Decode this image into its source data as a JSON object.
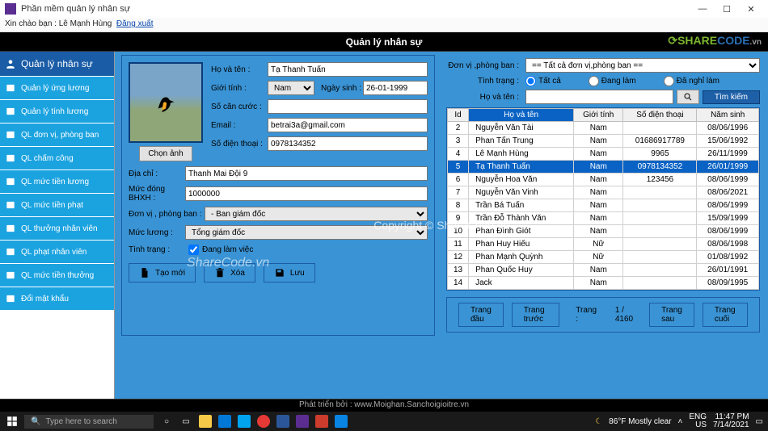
{
  "window": {
    "title": "Phần mềm quản lý nhân sự",
    "greeting_prefix": "Xin chào bạn : ",
    "greeting_user": "Lê Mạnh Hùng",
    "logout": "Đăng xuất"
  },
  "header": {
    "title": "Quản lý nhân sự"
  },
  "brand": {
    "share": "SHARE",
    "code": "CODE",
    "vn": ".vn"
  },
  "sidebar": {
    "head": "Quản lý nhân sự",
    "items": [
      {
        "label": "Quản lý ứng lương"
      },
      {
        "label": "Quản lý tính lương"
      },
      {
        "label": "QL đơn vị, phòng ban"
      },
      {
        "label": "QL chấm công"
      },
      {
        "label": "QL mức tiền lương"
      },
      {
        "label": "QL mức tiền phạt"
      },
      {
        "label": "QL thưởng nhân viên"
      },
      {
        "label": "QL phạt nhân viên"
      },
      {
        "label": "QL mức tiền thưởng"
      },
      {
        "label": "Đổi mật khẩu"
      }
    ]
  },
  "form": {
    "labels": {
      "hoten": "Họ và tên :",
      "gioitinh": "Giới tính :",
      "ngaysinh": "Ngày sinh :",
      "cccd": "Số căn cước :",
      "email": "Email :",
      "sdt": "Số điện thoại :",
      "diachi": "Địa chỉ :",
      "bhxh": "Mức đóng BHXH :",
      "donvi": "Đơn vị , phòng ban :",
      "luong": "Mức lương :",
      "tinhtrang": "Tình trạng :"
    },
    "values": {
      "hoten": "Tạ Thanh Tuấn",
      "gioitinh": "Nam",
      "ngaysinh": "26-01-1999",
      "cccd": "",
      "email": "betrai3a@gmail.com",
      "sdt": "0978134352",
      "diachi": "Thanh Mai Đội 9",
      "bhxh": "1000000",
      "donvi": "- Ban giám đốc",
      "luong": "Tổng giám đốc"
    },
    "chonanh": "Chọn ảnh",
    "workstatus": "Đang làm việc",
    "actions": {
      "new": "Tạo mới",
      "del": "Xóa",
      "save": "Lưu"
    }
  },
  "filters": {
    "labels": {
      "donvi": "Đơn vị ,phòng ban :",
      "tinhtrang": "Tình trạng :",
      "hoten": "Họ và tên :"
    },
    "donvi_value": "== Tất cả đơn vị,phòng ban ==",
    "radios": {
      "all": "Tất cả",
      "working": "Đang làm",
      "retired": "Đã nghỉ làm"
    },
    "search_btn": "Tìm kiếm"
  },
  "table": {
    "headers": [
      "Id",
      "Họ và tên",
      "Giới tính",
      "Số điện thoại",
      "Năm sinh"
    ],
    "rows": [
      {
        "id": "2",
        "name": "Nguyễn Văn Tài",
        "sex": "Nam",
        "phone": "",
        "dob": "08/06/1996"
      },
      {
        "id": "3",
        "name": "Phan Tấn Trung",
        "sex": "Nam",
        "phone": "01686917789",
        "dob": "15/06/1992"
      },
      {
        "id": "4",
        "name": "Lê Mạnh Hùng",
        "sex": "Nam",
        "phone": "9965",
        "dob": "26/11/1999"
      },
      {
        "id": "5",
        "name": "Tạ Thanh Tuấn",
        "sex": "Nam",
        "phone": "0978134352",
        "dob": "26/01/1999",
        "selected": true
      },
      {
        "id": "6",
        "name": "Nguyễn Hoa Văn",
        "sex": "Nam",
        "phone": "123456",
        "dob": "08/06/1999"
      },
      {
        "id": "7",
        "name": "Nguyễn Văn Vinh",
        "sex": "Nam",
        "phone": "",
        "dob": "08/06/2021"
      },
      {
        "id": "8",
        "name": "Trần Bá Tuấn",
        "sex": "Nam",
        "phone": "",
        "dob": "08/06/1999"
      },
      {
        "id": "9",
        "name": "Trần Đỗ Thành Văn",
        "sex": "Nam",
        "phone": "",
        "dob": "15/09/1999"
      },
      {
        "id": "10",
        "name": "Phan Đình Giót",
        "sex": "Nam",
        "phone": "",
        "dob": "08/06/1999"
      },
      {
        "id": "11",
        "name": "Phan Huy Hiếu",
        "sex": "Nữ",
        "phone": "",
        "dob": "08/06/1998"
      },
      {
        "id": "12",
        "name": "Phan Mạnh Quỳnh",
        "sex": "Nữ",
        "phone": "",
        "dob": "01/08/1992"
      },
      {
        "id": "13",
        "name": "Phan Quốc Huy",
        "sex": "Nam",
        "phone": "",
        "dob": "26/01/1991"
      },
      {
        "id": "14",
        "name": "Jack",
        "sex": "Nam",
        "phone": "",
        "dob": "08/09/1995"
      }
    ]
  },
  "pager": {
    "first": "Trang đầu",
    "prev": "Trang trước",
    "page_label": "Trang :",
    "page_value": "1 / 4160",
    "next": "Trang sau",
    "last": "Trang cuối"
  },
  "footerbar": "Phát triển bởi  : www.Moighan.Sanchoigioitre.vn",
  "taskbar": {
    "search_ph": "Type here to search",
    "weather": "86°F  Mostly clear",
    "lang": "ENG",
    "locale": "US",
    "time": "11:47 PM",
    "date": "7/14/2021"
  },
  "watermarks": {
    "center": "Copyright © ShareCode.vn",
    "left": "ShareCode.vn"
  }
}
